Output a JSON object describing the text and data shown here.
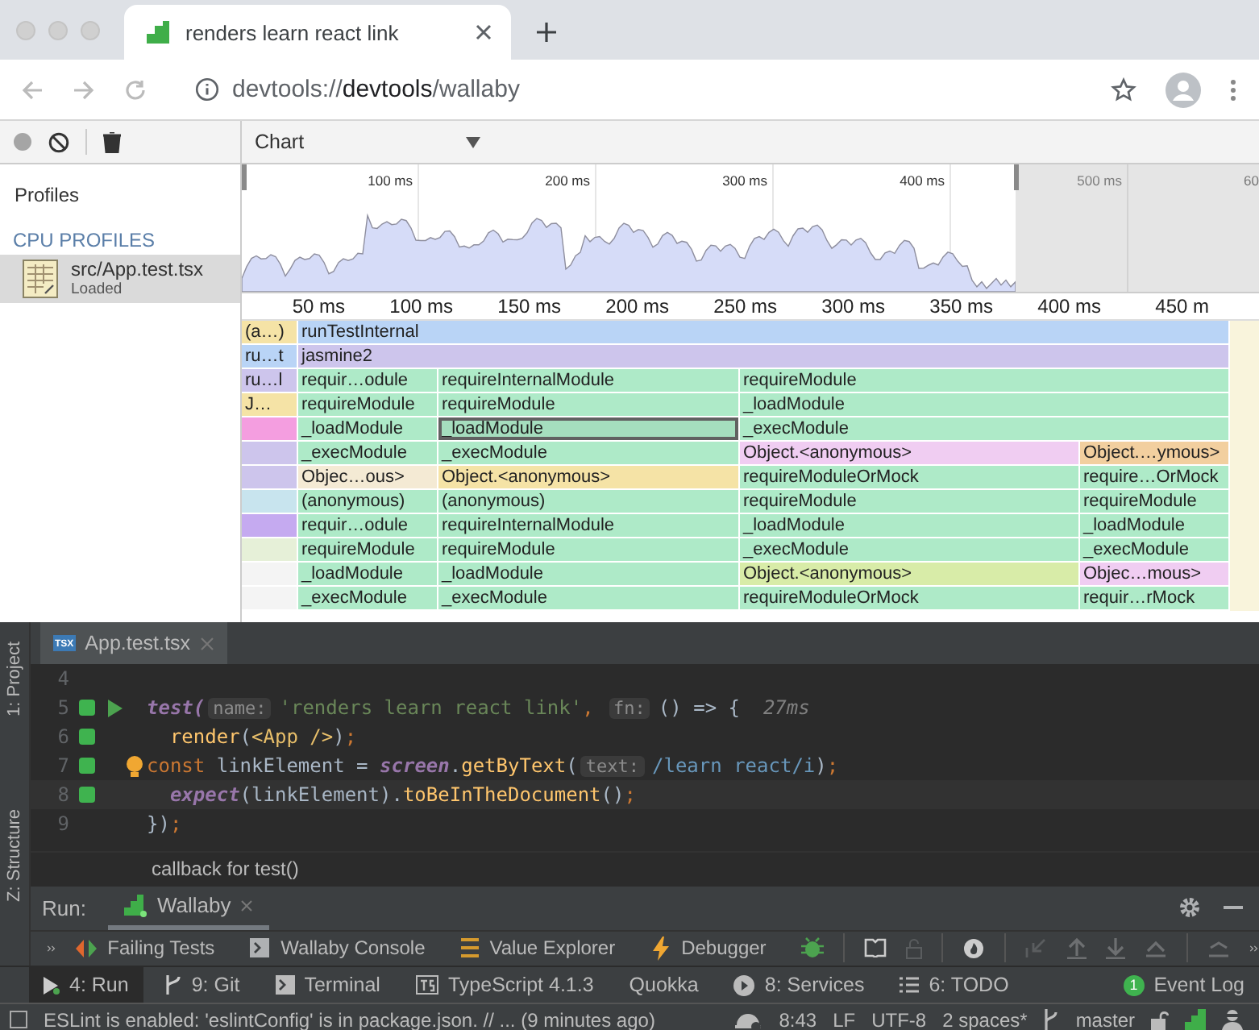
{
  "browser": {
    "tab": {
      "title": "renders learn react link"
    },
    "url": "devtools://**devtools**/wallaby"
  },
  "devtools": {
    "view_select": "Chart",
    "sidebar": {
      "heading": "Profiles",
      "section": "CPU PROFILES",
      "items": [
        {
          "name": "src/App.test.tsx",
          "status": "Loaded",
          "selected": true
        }
      ]
    },
    "overview_ticks": [
      "100 ms",
      "200 ms",
      "300 ms",
      "400 ms",
      "500 ms",
      "60"
    ],
    "ruler_ticks": [
      "50 ms",
      "100 ms",
      "150 ms",
      "200 ms",
      "250 ms",
      "300 ms",
      "350 ms",
      "400 ms",
      "450 m"
    ],
    "flame_rows": [
      [
        {
          "label": "(a…)",
          "color": "#f5e3a6",
          "selected": false
        },
        {
          "label": "runTestInternal",
          "color": "#b9d4f6",
          "selected": false
        }
      ],
      [
        {
          "label": "ru…t",
          "color": "#b9d4f6",
          "selected": false
        },
        {
          "label": "jasmine2",
          "color": "#cdc5ec",
          "selected": false
        }
      ],
      [
        {
          "label": "ru…l",
          "color": "#cdc5ec",
          "selected": false
        },
        {
          "label": "requir…odule",
          "color": "#aeeac8",
          "selected": false
        },
        {
          "label": "requireInternalModule",
          "color": "#aeeac8",
          "selected": false
        },
        {
          "label": "requireModule",
          "color": "#aeeac8",
          "selected": false
        }
      ],
      [
        {
          "label": "J…",
          "color": "#f5e3a6",
          "selected": false
        },
        {
          "label": "requireModule",
          "color": "#aeeac8",
          "selected": false
        },
        {
          "label": "requireModule",
          "color": "#aeeac8",
          "selected": false
        },
        {
          "label": "_loadModule",
          "color": "#aeeac8",
          "selected": false
        }
      ],
      [
        {
          "color": "#f49ee0",
          "selected": false
        },
        {
          "label": "_loadModule",
          "color": "#aeeac8",
          "selected": false
        },
        {
          "label": "_loadModule",
          "color": "#aeeac8",
          "selected": true
        },
        {
          "label": "_execModule",
          "color": "#aeeac8",
          "selected": false
        }
      ],
      [
        {
          "color": "#cdc5ec",
          "selected": false
        },
        {
          "label": "_execModule",
          "color": "#aeeac8",
          "selected": false
        },
        {
          "label": "_execModule",
          "color": "#aeeac8",
          "selected": false
        },
        {
          "label": "Object.<anonymous>",
          "color": "#f0cdf2",
          "selected": false
        },
        {
          "label": "Object.…ymous>",
          "color": "#f2cf9f",
          "selected": false
        }
      ],
      [
        {
          "color": "#cdc5ec",
          "selected": false
        },
        {
          "label": "Objec…ous>",
          "color": "#f4ead4",
          "selected": false
        },
        {
          "label": "Object.<anonymous>",
          "color": "#f5e3a6",
          "selected": false
        },
        {
          "label": "requireModuleOrMock",
          "color": "#aeeac8",
          "selected": false
        },
        {
          "label": "require…OrMock",
          "color": "#aeeac8",
          "selected": false
        }
      ],
      [
        {
          "color": "#c8e4ee",
          "selected": false
        },
        {
          "label": "(anonymous)",
          "color": "#aeeac8",
          "selected": false
        },
        {
          "label": "(anonymous)",
          "color": "#aeeac8",
          "selected": false
        },
        {
          "label": "requireModule",
          "color": "#aeeac8",
          "selected": false
        },
        {
          "label": "requireModule",
          "color": "#aeeac8",
          "selected": false
        }
      ],
      [
        {
          "color": "#c5aaf0",
          "selected": false
        },
        {
          "label": "requir…odule",
          "color": "#aeeac8",
          "selected": false
        },
        {
          "label": "requireInternalModule",
          "color": "#aeeac8",
          "selected": false
        },
        {
          "label": "_loadModule",
          "color": "#aeeac8",
          "selected": false
        },
        {
          "label": "_loadModule",
          "color": "#aeeac8",
          "selected": false
        }
      ],
      [
        {
          "color": "#e6f0d8",
          "selected": false
        },
        {
          "label": "requireModule",
          "color": "#aeeac8",
          "selected": false
        },
        {
          "label": "requireModule",
          "color": "#aeeac8",
          "selected": false
        },
        {
          "label": "_execModule",
          "color": "#aeeac8",
          "selected": false
        },
        {
          "label": "_execModule",
          "color": "#aeeac8",
          "selected": false
        }
      ],
      [
        {
          "color": "#f4f4f4",
          "selected": false
        },
        {
          "label": "_loadModule",
          "color": "#aeeac8",
          "selected": false
        },
        {
          "label": "_loadModule",
          "color": "#aeeac8",
          "selected": false
        },
        {
          "label": "Object.<anonymous>",
          "color": "#d8eca8",
          "selected": false
        },
        {
          "label": "Objec…mous>",
          "color": "#f0cdf2",
          "selected": false
        }
      ],
      [
        {
          "color": "#f4f4f4",
          "selected": false
        },
        {
          "label": "_execModule",
          "color": "#aeeac8",
          "selected": false
        },
        {
          "label": "_execModule",
          "color": "#aeeac8",
          "selected": false
        },
        {
          "label": "requireModuleOrMock",
          "color": "#aeeac8",
          "selected": false
        },
        {
          "label": "requir…rMock",
          "color": "#aeeac8",
          "selected": false
        }
      ]
    ]
  },
  "ide": {
    "side_tabs": [
      "1: Project",
      "Z: Structure"
    ],
    "editor_tab": "App.test.tsx",
    "file_badge": "TSX",
    "lines": [
      {
        "number": "4"
      },
      {
        "number": "5",
        "passed": true,
        "runnable": true,
        "tokens": [
          {
            "kind": "call",
            "text": "test("
          },
          {
            "kind": "hint",
            "text": "name:"
          },
          {
            "kind": "string",
            "text": "'renders learn react link'"
          },
          {
            "kind": "keyword",
            "text": ", "
          },
          {
            "kind": "hint",
            "text": "fn:"
          },
          {
            "kind": "plain",
            "text": "() => {  "
          },
          {
            "kind": "time",
            "text": "27ms"
          }
        ]
      },
      {
        "number": "6",
        "passed": true,
        "tokens": [
          {
            "kind": "fn",
            "text": "  render"
          },
          {
            "kind": "plain",
            "text": "("
          },
          {
            "kind": "tag",
            "text": "<App />"
          },
          {
            "kind": "plain",
            "text": ")"
          },
          {
            "kind": "keyword",
            "text": ";"
          }
        ]
      },
      {
        "number": "7",
        "passed": true,
        "bulb": true,
        "tokens": [
          {
            "kind": "keyword",
            "text": "const "
          },
          {
            "kind": "plain",
            "text": "linkElement = "
          },
          {
            "kind": "call",
            "text": "screen"
          },
          {
            "kind": "plain",
            "text": "."
          },
          {
            "kind": "fn",
            "text": "getByText"
          },
          {
            "kind": "plain",
            "text": "("
          },
          {
            "kind": "hint",
            "text": "text:"
          },
          {
            "kind": "regex",
            "text": "/learn react/i"
          },
          {
            "kind": "plain",
            "text": ")"
          },
          {
            "kind": "keyword",
            "text": ";"
          }
        ]
      },
      {
        "number": "8",
        "passed": true,
        "current": true,
        "tokens": [
          {
            "kind": "call",
            "text": "  expect"
          },
          {
            "kind": "plain",
            "text": "(linkElement)."
          },
          {
            "kind": "fn",
            "text": "toBeInTheDocument"
          },
          {
            "kind": "plain",
            "text": "()"
          },
          {
            "kind": "keyword",
            "text": ";"
          }
        ]
      },
      {
        "number": "9",
        "tokens": [
          {
            "kind": "plain",
            "text": "})"
          },
          {
            "kind": "keyword",
            "text": ";"
          }
        ]
      }
    ],
    "breadcrumb": "callback for test()",
    "run_label": "Run:",
    "run_tab": "Wallaby",
    "toolbar": [
      {
        "kind": "failing",
        "label": "Failing Tests"
      },
      {
        "kind": "console",
        "label": "Wallaby Console"
      },
      {
        "kind": "values",
        "label": "Value Explorer"
      },
      {
        "kind": "debugger",
        "label": "Debugger"
      }
    ],
    "tool_windows": [
      {
        "label": "4: Run",
        "kind": "run",
        "selected": true
      },
      {
        "label": "9: Git",
        "kind": "git",
        "selected": false
      },
      {
        "label": "Terminal",
        "kind": "terminal",
        "selected": false
      },
      {
        "label": "TypeScript 4.1.3",
        "kind": "ts",
        "selected": false
      },
      {
        "label": "Quokka",
        "kind": "none",
        "selected": false
      },
      {
        "label": "8: Services",
        "kind": "services",
        "selected": false
      },
      {
        "label": "6: TODO",
        "kind": "todo",
        "selected": false
      }
    ],
    "event_log": {
      "label": "Event Log",
      "count": "1"
    },
    "status": {
      "message": "ESLint is enabled: 'eslintConfig' is in package.json. // ... (9 minutes ago)",
      "position": "8:43",
      "line_sep": "LF",
      "encoding": "UTF-8",
      "indent": "2 spaces*",
      "branch": "master"
    }
  }
}
